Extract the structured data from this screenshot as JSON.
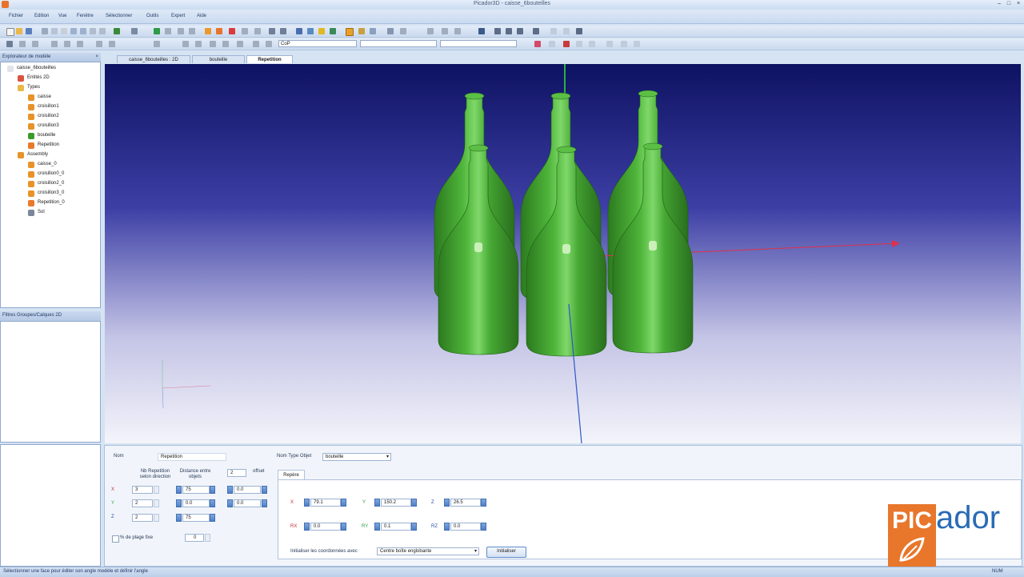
{
  "window": {
    "title": "Picador3D - caisse_6bouteilles"
  },
  "menu": [
    "Fichier",
    "Edition",
    "Vue",
    "Fenêtre",
    "Sélectionner",
    "Outils",
    "Expert",
    "Aide"
  ],
  "toolbar": {
    "combo1": "CoP",
    "combo2": "",
    "combo3": ""
  },
  "explorer": {
    "title": "Explorateur de modèle",
    "items": [
      {
        "label": "caisse_6bouteilles",
        "indent": 0,
        "icon": "document-icon"
      },
      {
        "label": "Entités 2D",
        "indent": 1,
        "icon": "entities-icon"
      },
      {
        "label": "Types",
        "indent": 1,
        "icon": "folder-icon"
      },
      {
        "label": "caisse",
        "indent": 2,
        "icon": "shape-icon"
      },
      {
        "label": "croisillon1",
        "indent": 2,
        "icon": "shape-icon"
      },
      {
        "label": "croisillon2",
        "indent": 2,
        "icon": "shape-icon"
      },
      {
        "label": "croisillon3",
        "indent": 2,
        "icon": "shape-icon"
      },
      {
        "label": "bouteille",
        "indent": 2,
        "icon": "bottle-icon"
      },
      {
        "label": "Repetition",
        "indent": 2,
        "icon": "repeat-icon"
      },
      {
        "label": "Assembly",
        "indent": 1,
        "icon": "assembly-icon"
      },
      {
        "label": "caisse_0",
        "indent": 2,
        "icon": "shape-icon"
      },
      {
        "label": "croisillon0_0",
        "indent": 2,
        "icon": "shape-icon"
      },
      {
        "label": "croisillon2_0",
        "indent": 2,
        "icon": "shape-icon"
      },
      {
        "label": "croisillon3_0",
        "indent": 2,
        "icon": "shape-icon"
      },
      {
        "label": "Repetition_0",
        "indent": 2,
        "icon": "repeat-icon"
      },
      {
        "label": "Sol",
        "indent": 2,
        "icon": "floor-icon"
      }
    ]
  },
  "layers": {
    "title": "Filtres Groupes/Calques 2D"
  },
  "tabs": [
    {
      "label": "caisse_6bouteilles : 2D",
      "active": false
    },
    {
      "label": "bouteille",
      "active": false
    },
    {
      "label": "Repetition",
      "active": true
    }
  ],
  "props": {
    "name_label": "Nom",
    "name_value": "Repetition",
    "col_repeat": "Nb Repetition selon direction",
    "col_distance": "Distance entre objets",
    "col_offset_select": "2",
    "col_offset": "offset",
    "axes": [
      "X",
      "Y",
      "Z"
    ],
    "repeats": [
      "3",
      "2",
      "2"
    ],
    "distances": [
      "75",
      "0.0",
      "75"
    ],
    "offsets": [
      "0.0",
      "0.0"
    ],
    "range_label": "% de plage fixe",
    "range_value": "0",
    "type_label": "Nom Type Objet",
    "type_value": "bouteille",
    "repere_tab": "Repère",
    "pos": [
      {
        "label": "X",
        "value": "79.1"
      },
      {
        "label": "Y",
        "value": "150.2"
      },
      {
        "label": "Z",
        "value": "26.5"
      }
    ],
    "rot": [
      {
        "label": "RX",
        "value": "0.0"
      },
      {
        "label": "RY",
        "value": "0.1"
      },
      {
        "label": "RZ",
        "value": "0.0"
      }
    ],
    "init_label": "Initialiser les coordonnées avec",
    "init_value": "Centre boîte englobante",
    "init_button": "Initialiser"
  },
  "logo": {
    "pic": "PIC",
    "ador": "ador"
  },
  "statusbar": {
    "text": "Sélectionner une face pour éditer son angle modèle et définir l'angle",
    "right": "NUM"
  },
  "colors": {
    "bottle": "#3f9e2d",
    "axis_x": "#e0304a",
    "axis_y": "#28b43c",
    "axis_z": "#2d58c8",
    "logo_orange": "#e8762b",
    "logo_blue": "#2a6bb5"
  }
}
